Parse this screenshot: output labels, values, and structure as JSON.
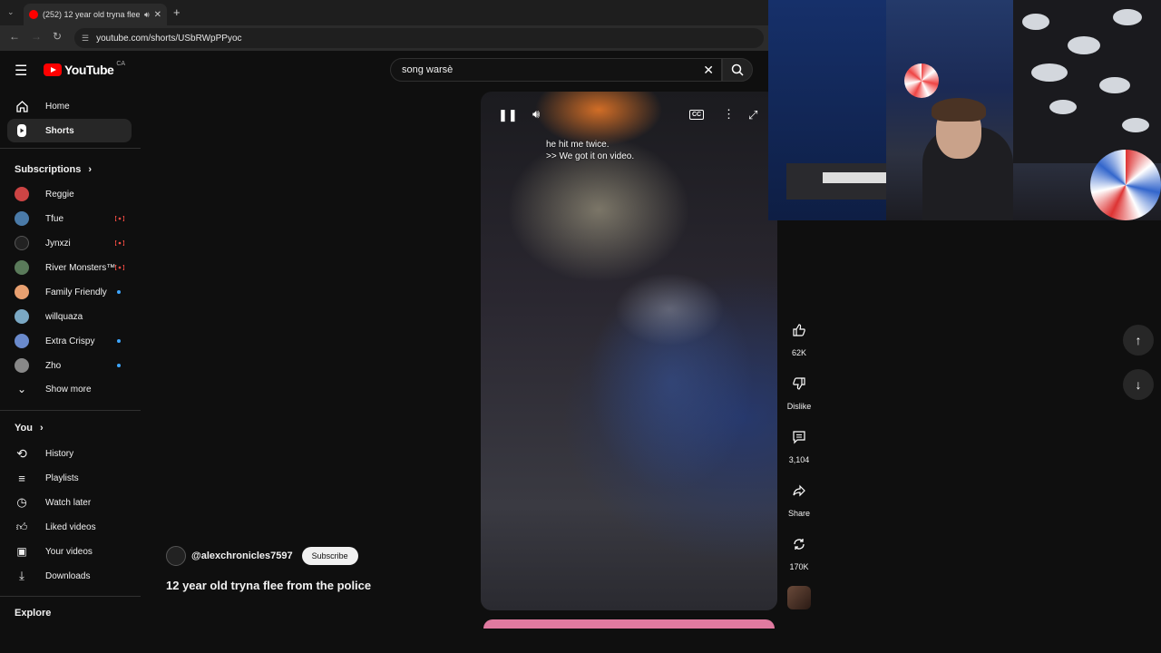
{
  "browser": {
    "tab_title": "(252) 12 year old tryna flee",
    "url": "youtube.com/shorts/USbRWpPPyoc"
  },
  "masthead": {
    "logo": "YouTube",
    "country": "CA",
    "search_value": "song warsè"
  },
  "sidebar": {
    "main": [
      {
        "label": "Home",
        "icon": "home-icon"
      },
      {
        "label": "Shorts",
        "icon": "shorts-icon"
      }
    ],
    "subscriptions_heading": "Subscriptions",
    "subscriptions": [
      {
        "label": "Reggie",
        "status": "none",
        "color": "#c44"
      },
      {
        "label": "Tfue",
        "status": "live",
        "color": "#4a7aa8"
      },
      {
        "label": "Jynxzi",
        "status": "live",
        "color": "#222"
      },
      {
        "label": "River Monsters™",
        "status": "live",
        "color": "#5a7a5a"
      },
      {
        "label": "Family Friendly",
        "status": "new",
        "color": "#e8a070"
      },
      {
        "label": "willquaza",
        "status": "none",
        "color": "#7aa8c4"
      },
      {
        "label": "Extra Crispy",
        "status": "new",
        "color": "#6a8acc"
      },
      {
        "label": "Zho",
        "status": "new",
        "color": "#888"
      }
    ],
    "show_more": "Show more",
    "you_heading": "You",
    "you": [
      {
        "label": "History",
        "icon": "history-icon"
      },
      {
        "label": "Playlists",
        "icon": "playlists-icon"
      },
      {
        "label": "Watch later",
        "icon": "watch-later-icon"
      },
      {
        "label": "Liked videos",
        "icon": "like-icon"
      },
      {
        "label": "Your videos",
        "icon": "your-videos-icon"
      },
      {
        "label": "Downloads",
        "icon": "download-icon"
      }
    ],
    "explore_heading": "Explore"
  },
  "video": {
    "caption_line1": "he hit me twice.",
    "caption_line2": ">> We got it on video.",
    "channel": "@alexchronicles7597",
    "subscribe": "Subscribe",
    "title": "12 year old tryna flee from the police"
  },
  "actions": {
    "likes": "62K",
    "dislike": "Dislike",
    "comments": "3,104",
    "share": "Share",
    "remix": "170K"
  },
  "colors": {
    "accent": "#ff0000",
    "background": "#0f0f0f",
    "live_badge": "#ff4e45",
    "new_dot": "#3ea6ff"
  }
}
